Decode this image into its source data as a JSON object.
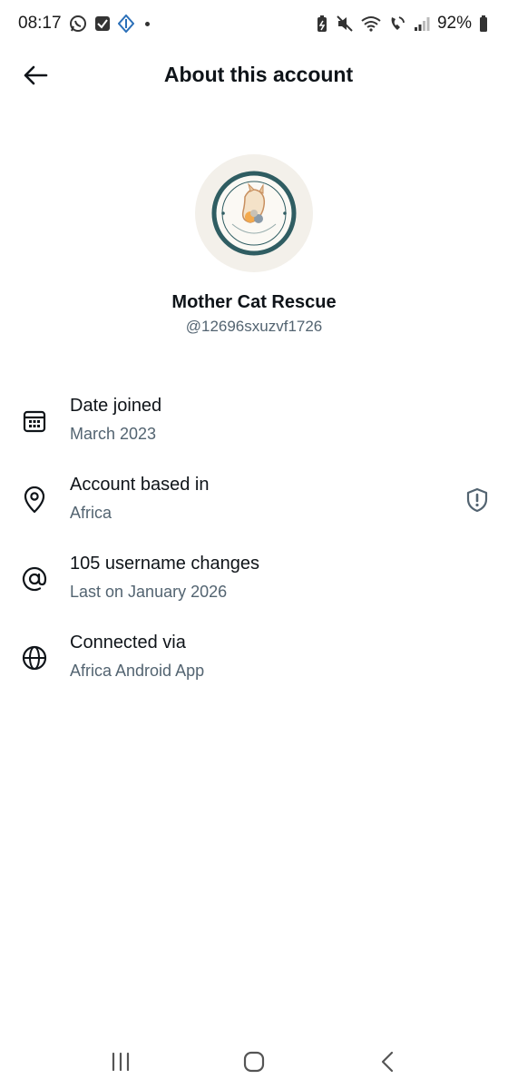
{
  "status_bar": {
    "time": "08:17",
    "battery": "92%",
    "left_icons": [
      "whatsapp-icon",
      "checkbox-icon",
      "app-icon"
    ],
    "right_icons": [
      "battery-saver-icon",
      "mute-icon",
      "wifi-icon",
      "wifi-calling-icon",
      "signal-icon"
    ]
  },
  "header": {
    "title": "About this account"
  },
  "profile": {
    "name": "Mother Cat Rescue",
    "handle": "@12696sxuzvf1726",
    "avatar_text": "MOTHER CAT RESCUE"
  },
  "info": [
    {
      "icon": "calendar-icon",
      "title": "Date joined",
      "subtitle": "March 2023"
    },
    {
      "icon": "location-pin-icon",
      "title": "Account based in",
      "subtitle": "Africa",
      "action_icon": "shield-alert-icon"
    },
    {
      "icon": "at-sign-icon",
      "title": "105 username changes",
      "subtitle": "Last on January 2026"
    },
    {
      "icon": "globe-icon",
      "title": "Connected via",
      "subtitle": "Africa Android App"
    }
  ],
  "nav_bar": {
    "icons": [
      "recent-apps-icon",
      "home-icon",
      "back-nav-icon"
    ]
  },
  "colors": {
    "text_primary": "#0f1419",
    "text_secondary": "#536471",
    "avatar_ring": "#2f5d62",
    "avatar_bg": "#f3f0ea"
  }
}
